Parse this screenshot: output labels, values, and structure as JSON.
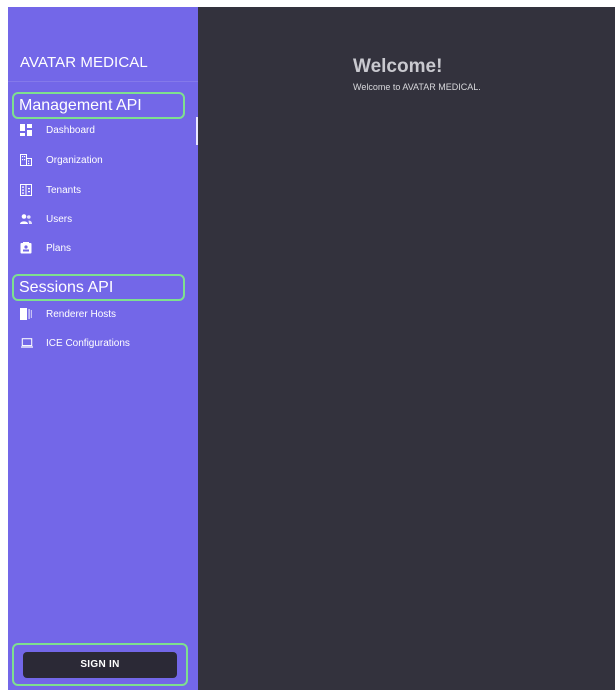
{
  "sidebar": {
    "brand": "AVATAR MEDICAL",
    "management_section": "Management API",
    "management_items": [
      {
        "label": "Dashboard",
        "icon": "dashboard-icon"
      },
      {
        "label": "Organization",
        "icon": "organization-icon"
      },
      {
        "label": "Tenants",
        "icon": "tenants-icon"
      },
      {
        "label": "Users",
        "icon": "users-icon"
      },
      {
        "label": "Plans",
        "icon": "plans-icon"
      }
    ],
    "sessions_section": "Sessions API",
    "sessions_items": [
      {
        "label": "Renderer Hosts",
        "icon": "renderer-hosts-icon"
      },
      {
        "label": "ICE Configurations",
        "icon": "laptop-icon"
      }
    ],
    "signin_label": "SIGN IN"
  },
  "main": {
    "title": "Welcome!",
    "subtitle": "Welcome to AVATAR MEDICAL."
  },
  "colors": {
    "sidebar": "#7367e8",
    "main": "#33323d",
    "highlight": "#7ee08f",
    "button": "#2b2936"
  }
}
